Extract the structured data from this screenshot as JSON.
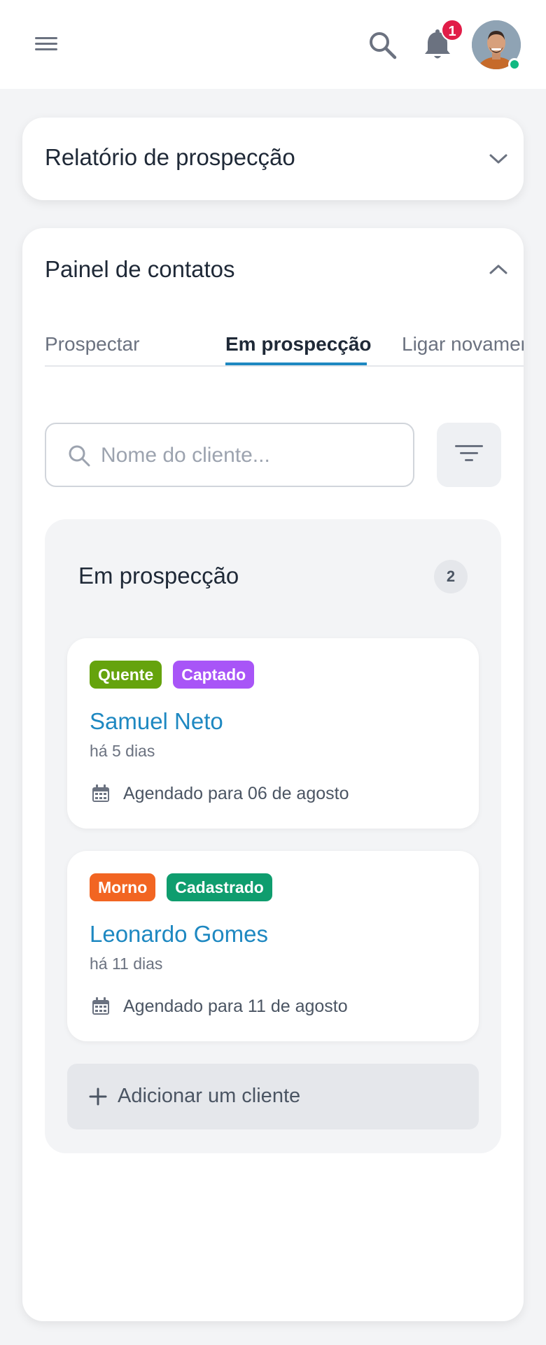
{
  "header": {
    "menu_icon": "hamburger-icon",
    "search_icon": "search-icon",
    "bell_icon": "bell-icon",
    "notification_count": "1",
    "avatar": "user-avatar",
    "online_color": "#10b981"
  },
  "report_card": {
    "title": "Relatório de prospecção",
    "icon": "chevron-down-icon"
  },
  "panel": {
    "title": "Painel de contatos",
    "icon": "chevron-up-icon",
    "tabs": [
      {
        "label": "Prospectar",
        "active": false
      },
      {
        "label": "Em prospecção",
        "active": true
      },
      {
        "label": "Ligar novamente",
        "active": false
      }
    ],
    "search": {
      "placeholder": "Nome do cliente...",
      "value": ""
    },
    "filter_icon": "filter-icon",
    "column": {
      "title": "Em prospecção",
      "count": "2",
      "clients": [
        {
          "tags": [
            {
              "label": "Quente",
              "color": "#65a30d"
            },
            {
              "label": "Captado",
              "color": "#a855f7"
            }
          ],
          "name": "Samuel Neto",
          "ago": "há 5 dias",
          "scheduled": "Agendado para 06 de agosto"
        },
        {
          "tags": [
            {
              "label": "Morno",
              "color": "#f26522"
            },
            {
              "label": "Cadastrado",
              "color": "#0f9d6e"
            }
          ],
          "name": "Leonardo Gomes",
          "ago": "há 11 dias",
          "scheduled": "Agendado para 11 de agosto"
        }
      ],
      "add_label": "Adicionar um cliente"
    }
  },
  "colors": {
    "accent": "#1e88c1",
    "badge": "#e11d48"
  }
}
